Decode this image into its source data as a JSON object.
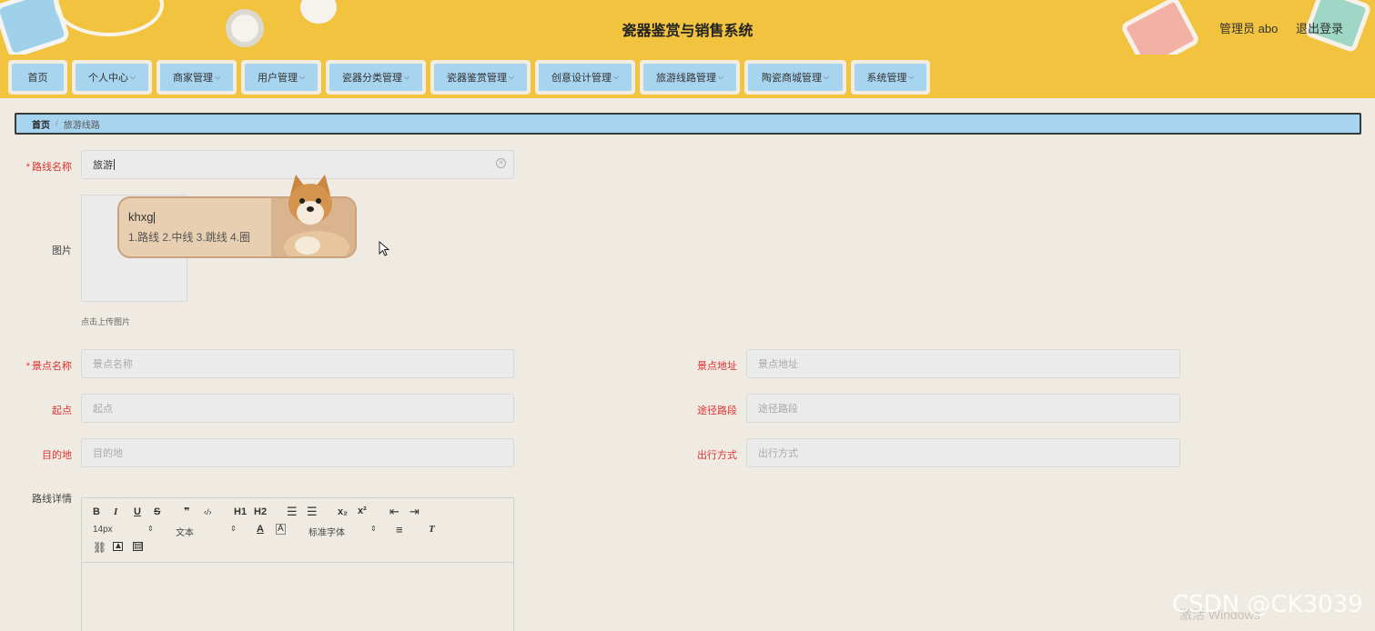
{
  "header": {
    "title": "瓷器鉴赏与销售系统",
    "user": "管理员 abo",
    "logout": "退出登录"
  },
  "nav": {
    "items": [
      {
        "label": "首页",
        "has_menu": false
      },
      {
        "label": "个人中心",
        "has_menu": true
      },
      {
        "label": "商家管理",
        "has_menu": true
      },
      {
        "label": "用户管理",
        "has_menu": true
      },
      {
        "label": "瓷器分类管理",
        "has_menu": true
      },
      {
        "label": "瓷器鉴赏管理",
        "has_menu": true
      },
      {
        "label": "创意设计管理",
        "has_menu": true
      },
      {
        "label": "旅游线路管理",
        "has_menu": true
      },
      {
        "label": "陶瓷商城管理",
        "has_menu": true
      },
      {
        "label": "系统管理",
        "has_menu": true
      }
    ]
  },
  "breadcrumb": {
    "home": "首页",
    "separator": "/",
    "current": "旅游线路"
  },
  "form": {
    "route_name": {
      "label": "路线名称",
      "value": "旅游"
    },
    "image": {
      "label": "图片",
      "hint": "点击上传图片"
    },
    "spot_name": {
      "label": "景点名称",
      "placeholder": "景点名称"
    },
    "spot_address": {
      "label": "景点地址",
      "placeholder": "景点地址"
    },
    "start": {
      "label": "起点",
      "placeholder": "起点"
    },
    "via": {
      "label": "途径路段",
      "placeholder": "途径路段"
    },
    "destination": {
      "label": "目的地",
      "placeholder": "目的地"
    },
    "travel_mode": {
      "label": "出行方式",
      "placeholder": "出行方式"
    },
    "details": {
      "label": "路线详情"
    }
  },
  "ime": {
    "pinyin": "khxg",
    "candidates": "1.路线  2.中线  3.跳线  4.圈"
  },
  "editor": {
    "size": "14px",
    "format": "文本",
    "font": "标准字体",
    "buttons": {
      "bold": "B",
      "italic": "I",
      "underline": "U",
      "strike": "S",
      "quote": "❞",
      "code": "‹/›",
      "h1": "H1",
      "h2": "H2",
      "sub": "x₂",
      "sup": "x²"
    }
  },
  "watermark": {
    "csdn": "CSDN @CK3039",
    "windows": "激活 Windows"
  },
  "colors": {
    "header_bg": "#f1c33f",
    "nav_item_bg": "#a7d4ef",
    "page_bg": "#efebe2",
    "required": "#d33333"
  }
}
